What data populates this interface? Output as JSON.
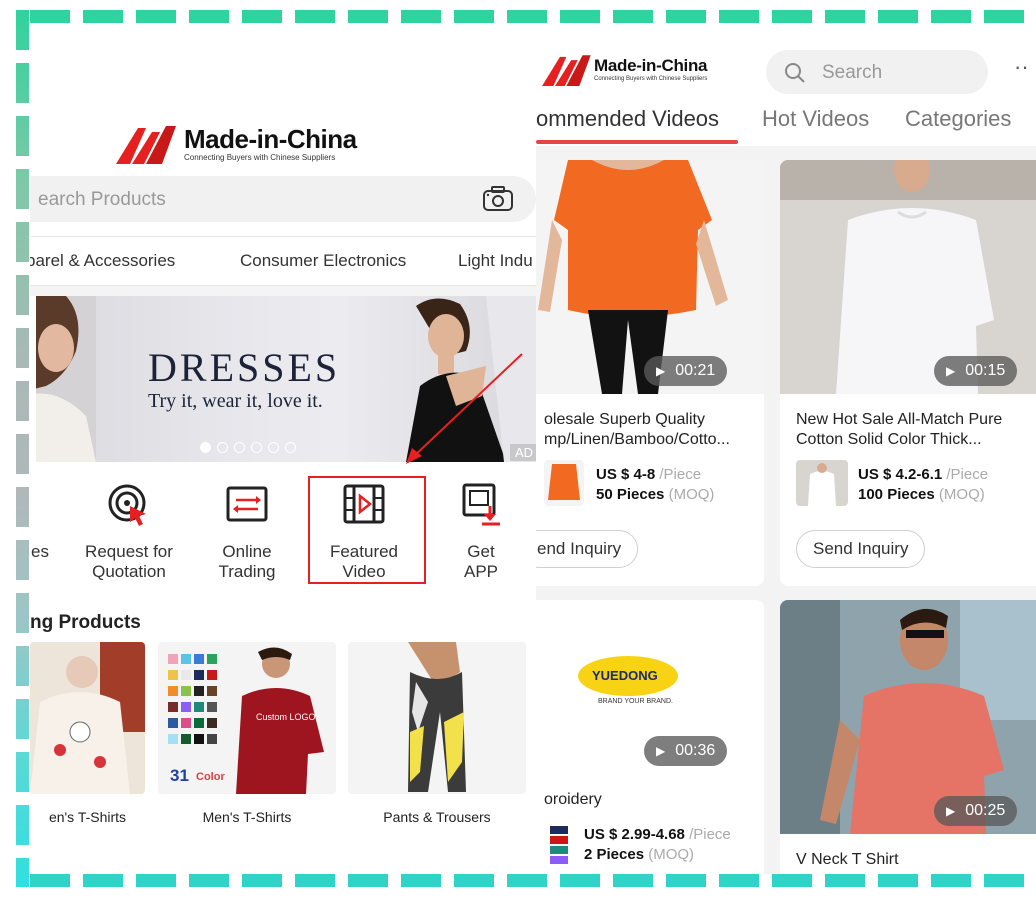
{
  "colors": {
    "brand_red": "#e62020",
    "frame_green": "#2fd3a0",
    "frame_cyan": "#2fe0e0",
    "tab_accent": "#e64545"
  },
  "home": {
    "logo": {
      "name": "Made-in-China",
      "tagline": "Connecting Buyers with Chinese Suppliers"
    },
    "search_placeholder": "earch Products",
    "camera_icon": "camera-icon",
    "categories": [
      "parel & Accessories",
      "Consumer Electronics",
      "Light Indu"
    ],
    "banner": {
      "headline": "DRESSES",
      "subline": "Try it, wear it, love it.",
      "ad": "AD",
      "slide_count": 6,
      "active_slide": 1
    },
    "menu": [
      {
        "label_line1": "",
        "label_line2": "es",
        "icon": "partial-icon"
      },
      {
        "label_line1": "Request for",
        "label_line2": "Quotation",
        "icon": "target-icon"
      },
      {
        "label_line1": "Online",
        "label_line2": "Trading",
        "icon": "exchange-icon"
      },
      {
        "label_line1": "Featured",
        "label_line2": "Video",
        "icon": "film-icon"
      },
      {
        "label_line1": "Get",
        "label_line2": "APP",
        "icon": "download-icon"
      }
    ],
    "section_title": "ng Products",
    "products": [
      {
        "caption": "en's T-Shirts"
      },
      {
        "caption": "Men's T-Shirts",
        "badge_number": "31",
        "badge_word": "Color",
        "shirt_text": "Custom LOGO"
      },
      {
        "caption": "Pants & Trousers"
      }
    ]
  },
  "video": {
    "logo": {
      "name": "Made-in-China",
      "tagline": "Connecting Buyers with Chinese Suppliers"
    },
    "search_placeholder": "Search",
    "more": "··",
    "tabs": [
      "ommended Videos",
      "Hot Videos",
      "Categories"
    ],
    "cards": [
      {
        "duration": "00:21",
        "title1": "olesale Superb Quality",
        "title2": "mp/Linen/Bamboo/Cotto...",
        "price": "US $ 4-8",
        "unit": " /Piece",
        "moq": "50 Pieces",
        "moq_label": " (MOQ)",
        "button": "end Inquiry"
      },
      {
        "duration": "00:15",
        "title1": "New Hot Sale All-Match Pure",
        "title2": "Cotton Solid Color Thick...",
        "price": "US $ 4.2-6.1",
        "unit": " /Piece",
        "moq": "100 Pieces",
        "moq_label": " (MOQ)",
        "button": "Send Inquiry"
      },
      {
        "duration": "00:36",
        "brand": "YUEDONG",
        "brand_sub": "BRAND YOUR BRAND.",
        "title1": "oroidery",
        "price": "US $ 2.99-4.68",
        "unit": " /Piece",
        "moq": "2 Pieces",
        "moq_label": " (MOQ)"
      },
      {
        "duration": "00:25",
        "title1": "V Neck T Shirt"
      }
    ]
  }
}
